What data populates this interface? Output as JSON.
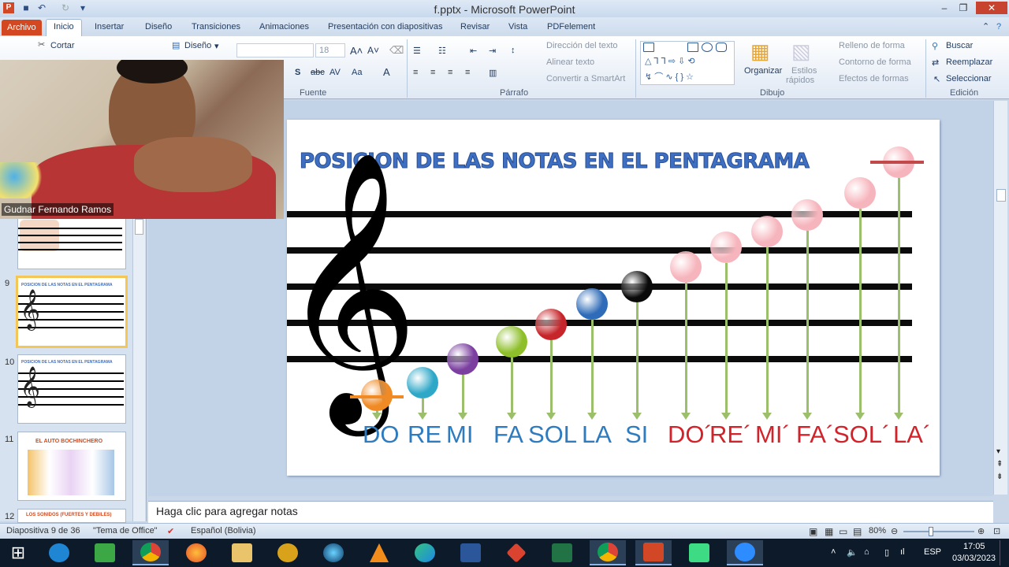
{
  "window": {
    "title": "f.pptx - Microsoft PowerPoint"
  },
  "tabs": [
    "Archivo",
    "Inicio",
    "Insertar",
    "Diseño",
    "Transiciones",
    "Animaciones",
    "Presentación con diapositivas",
    "Revisar",
    "Vista",
    "PDFelement"
  ],
  "ribbon": {
    "cut": "Cortar",
    "design": "Diseño",
    "font_size": "18",
    "group_font": "Fuente",
    "group_paragraph": "Párrafo",
    "group_drawing": "Dibujo",
    "group_edit": "Edición",
    "text_direction": "Dirección del texto",
    "align_text": "Alinear texto",
    "convert_smartart": "Convertir a SmartArt",
    "organize": "Organizar",
    "quick_styles_1": "Estilos",
    "quick_styles_2": "rápidos",
    "shape_fill": "Relleno de forma",
    "shape_outline": "Contorno de forma",
    "shape_effects": "Efectos de formas",
    "find": "Buscar",
    "replace": "Reemplazar",
    "select": "Seleccionar"
  },
  "webcam": {
    "name": "Gudnar Fernando Ramos"
  },
  "thumbnails": [
    {
      "num": "9",
      "selected": true
    },
    {
      "num": "10",
      "selected": false
    },
    {
      "num": "11",
      "selected": false,
      "title": "EL AUTO BOCHINCHERO"
    },
    {
      "num": "12",
      "selected": false,
      "title": "LOS SONIDOS (FUERTES Y DEBILES)"
    }
  ],
  "slide": {
    "title": "POSICION DE LAS NOTAS EN EL PENTAGRAMA",
    "notes_low": [
      {
        "label": "DO",
        "color": "#f08a24"
      },
      {
        "label": "RE",
        "color": "#2fa8c8"
      },
      {
        "label": "MI",
        "color": "#7b3fa0"
      },
      {
        "label": "FA",
        "color": "#8ebf2a"
      },
      {
        "label": "SOL",
        "color": "#c6262b"
      },
      {
        "label": "LA",
        "color": "#2e6bb8"
      },
      {
        "label": "SI",
        "color": "#0a0a0a"
      }
    ],
    "notes_high": [
      {
        "label": "DO´",
        "color": "#f6b4bc"
      },
      {
        "label": "RE´",
        "color": "#f6b4bc"
      },
      {
        "label": "MI´",
        "color": "#f6b4bc"
      },
      {
        "label": "FA´",
        "color": "#f6b4bc"
      },
      {
        "label": "SOL´",
        "color": "#f6b4bc"
      },
      {
        "label": "LA´",
        "color": "#f6b4bc"
      }
    ],
    "low_label_color": "#2e7bbf",
    "high_label_color": "#d2232a"
  },
  "notes_pane": {
    "placeholder": "Haga clic para agregar notas"
  },
  "status": {
    "slide_counter": "Diapositiva 9 de 36",
    "theme": "\"Tema de Office\"",
    "language": "Español (Bolivia)",
    "zoom": "80%"
  },
  "taskbar": {
    "lang": "ESP",
    "time": "17:05",
    "date": "03/03/2023"
  }
}
